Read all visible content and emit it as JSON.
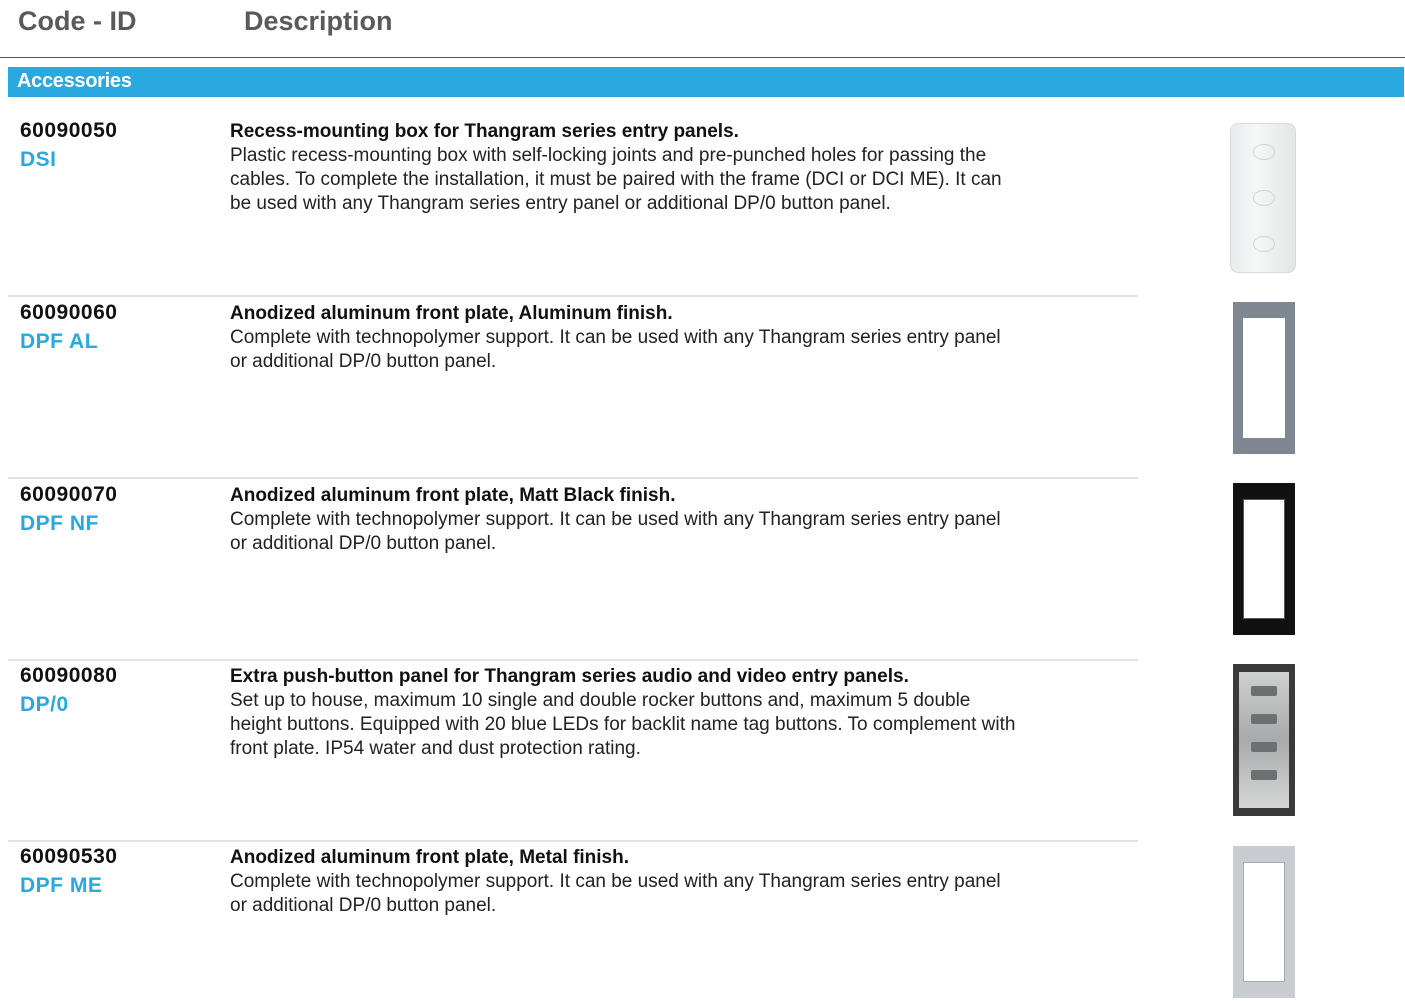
{
  "header": {
    "code_label": "Code - ID",
    "description_label": "Description"
  },
  "section": {
    "title": "Accessories",
    "color": "#2aa8e0"
  },
  "products": [
    {
      "code": "60090050",
      "id": "DSI",
      "title": "Recess-mounting box for Thangram series entry panels.",
      "text": "Plastic recess-mounting box with self-locking joints and pre-punched holes for passing the cables. To complete the installation, it must be paired with the frame (DCI or DCI ME). It can be used with any Thangram series entry panel or additional DP/0 button panel.",
      "image": "recess-box"
    },
    {
      "code": "60090060",
      "id": "DPF AL",
      "title": "Anodized aluminum front plate, Aluminum finish.",
      "text": "Complete with technopolymer support. It can be used with any Thangram series entry panel or additional DP/0 button panel.",
      "image": "aluminum-front-plate"
    },
    {
      "code": "60090070",
      "id": "DPF NF",
      "title": "Anodized aluminum front plate, Matt Black finish.",
      "text": "Complete with technopolymer support. It can be used with any Thangram series entry panel or additional DP/0 button panel.",
      "image": "black-front-plate"
    },
    {
      "code": "60090080",
      "id": "DP/0",
      "title": "Extra push-button panel for Thangram series audio and video entry panels.",
      "text": "Set up to house, maximum 10 single and double rocker buttons and, maximum 5 double height buttons. Equipped with 20 blue LEDs for backlit name tag buttons. To complement with front plate. IP54 water and dust protection rating.",
      "image": "push-button-panel"
    },
    {
      "code": "60090530",
      "id": "DPF ME",
      "title": "Anodized aluminum front plate, Metal finish.",
      "text": "Complete with technopolymer support. It can be used with any Thangram series entry panel or additional DP/0 button panel.",
      "image": "metal-front-plate"
    }
  ]
}
